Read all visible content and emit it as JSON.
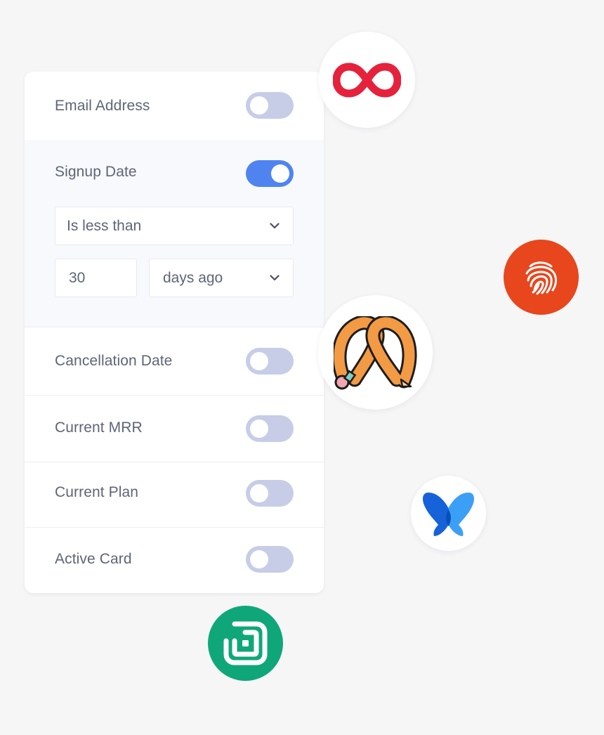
{
  "filters": [
    {
      "label": "Email Address",
      "enabled": false
    },
    {
      "label": "Signup Date",
      "enabled": true
    },
    {
      "label": "Cancellation Date",
      "enabled": false
    },
    {
      "label": "Current MRR",
      "enabled": false
    },
    {
      "label": "Current Plan",
      "enabled": false
    },
    {
      "label": "Active Card",
      "enabled": false
    }
  ],
  "signup_condition": {
    "operator": "Is less than",
    "amount": "30",
    "unit": "days ago"
  },
  "integration_icons": [
    {
      "name": "infinity-logo-icon",
      "color": "#e5213c"
    },
    {
      "name": "fingerprint-logo-icon",
      "color": "#e8461c"
    },
    {
      "name": "pretzel-pencil-logo-icon",
      "color": "#f39a44"
    },
    {
      "name": "butterfly-logo-icon",
      "color": "#1e74e8"
    },
    {
      "name": "square-spiral-logo-icon",
      "color": "#0fa77a"
    }
  ],
  "colors": {
    "toggle_on": "#4f84f0",
    "toggle_off": "#c7cde7",
    "label_text": "#5f6577",
    "expanded_row_bg": "#f8f9fd"
  }
}
